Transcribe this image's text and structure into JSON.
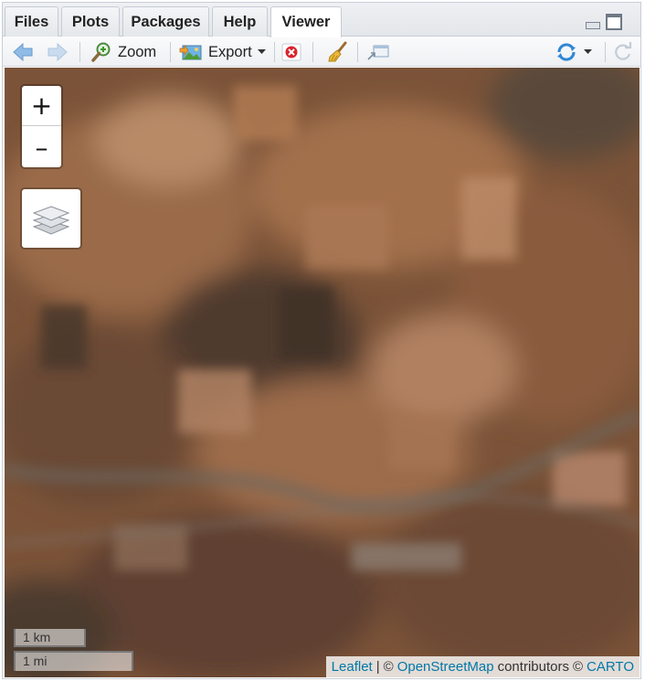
{
  "tabs": [
    {
      "label": "Files"
    },
    {
      "label": "Plots"
    },
    {
      "label": "Packages"
    },
    {
      "label": "Help"
    },
    {
      "label": "Viewer",
      "active": true
    }
  ],
  "toolbar": {
    "zoom_label": "Zoom",
    "export_label": "Export"
  },
  "map": {
    "zoom_in_label": "+",
    "zoom_out_label": "–",
    "scale_km": "1 km",
    "scale_mi": "1 mi",
    "attribution": {
      "leaflet": "Leaflet",
      "separator": "|",
      "copyright1": "©",
      "osm": "OpenStreetMap",
      "contributors": "contributors",
      "copyright2": "©",
      "carto": "CARTO"
    }
  },
  "icons": {
    "back": "arrow-left-icon",
    "forward": "arrow-right-icon",
    "zoom": "magnifier-icon",
    "export": "image-export-icon",
    "remove": "red-x-icon",
    "clear": "broom-icon",
    "popout": "popout-icon",
    "sync": "sync-icon",
    "refresh": "refresh-icon",
    "layers": "layers-icon"
  },
  "colors": {
    "accent_blue": "#3b8fd8",
    "link": "#0078a8",
    "remove_red": "#d9232d"
  }
}
